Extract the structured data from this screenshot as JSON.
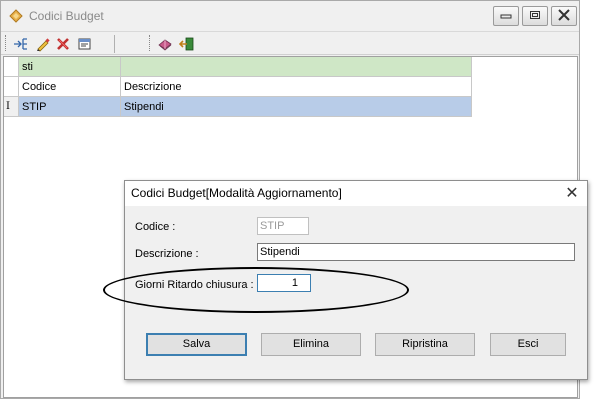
{
  "window": {
    "title": "Codici Budget",
    "minimize_icon": "minimize-icon",
    "maximize_icon": "maximize-icon",
    "close_icon": "close-icon"
  },
  "toolbar": {
    "items": [
      {
        "icon": "new-record-icon"
      },
      {
        "icon": "edit-pencil-icon"
      },
      {
        "icon": "delete-x-icon"
      },
      {
        "icon": "properties-icon"
      },
      {
        "icon": "print-book-icon"
      },
      {
        "icon": "exit-door-icon"
      }
    ]
  },
  "grid": {
    "group_label": "sti",
    "columns": [
      "Codice",
      "Descrizione"
    ],
    "rows": [
      {
        "indicator": "I",
        "codice": "STIP",
        "descrizione": "Stipendi"
      }
    ]
  },
  "dialog": {
    "title": "Codici Budget[Modalità Aggiornamento]",
    "close_glyph": "✕",
    "fields": {
      "codice_label": "Codice :",
      "codice_value": "STIP",
      "descrizione_label": "Descrizione :",
      "descrizione_value": "Stipendi",
      "giorni_label": "Giorni Ritardo chiusura :",
      "giorni_value": "1"
    },
    "buttons": {
      "salva": "Salva",
      "elimina": "Elimina",
      "ripristina": "Ripristina",
      "esci": "Esci"
    }
  },
  "colors": {
    "group_row": "#cfe7c6",
    "selected_row": "#b8cce8",
    "focus_border": "#3c7fb1"
  }
}
